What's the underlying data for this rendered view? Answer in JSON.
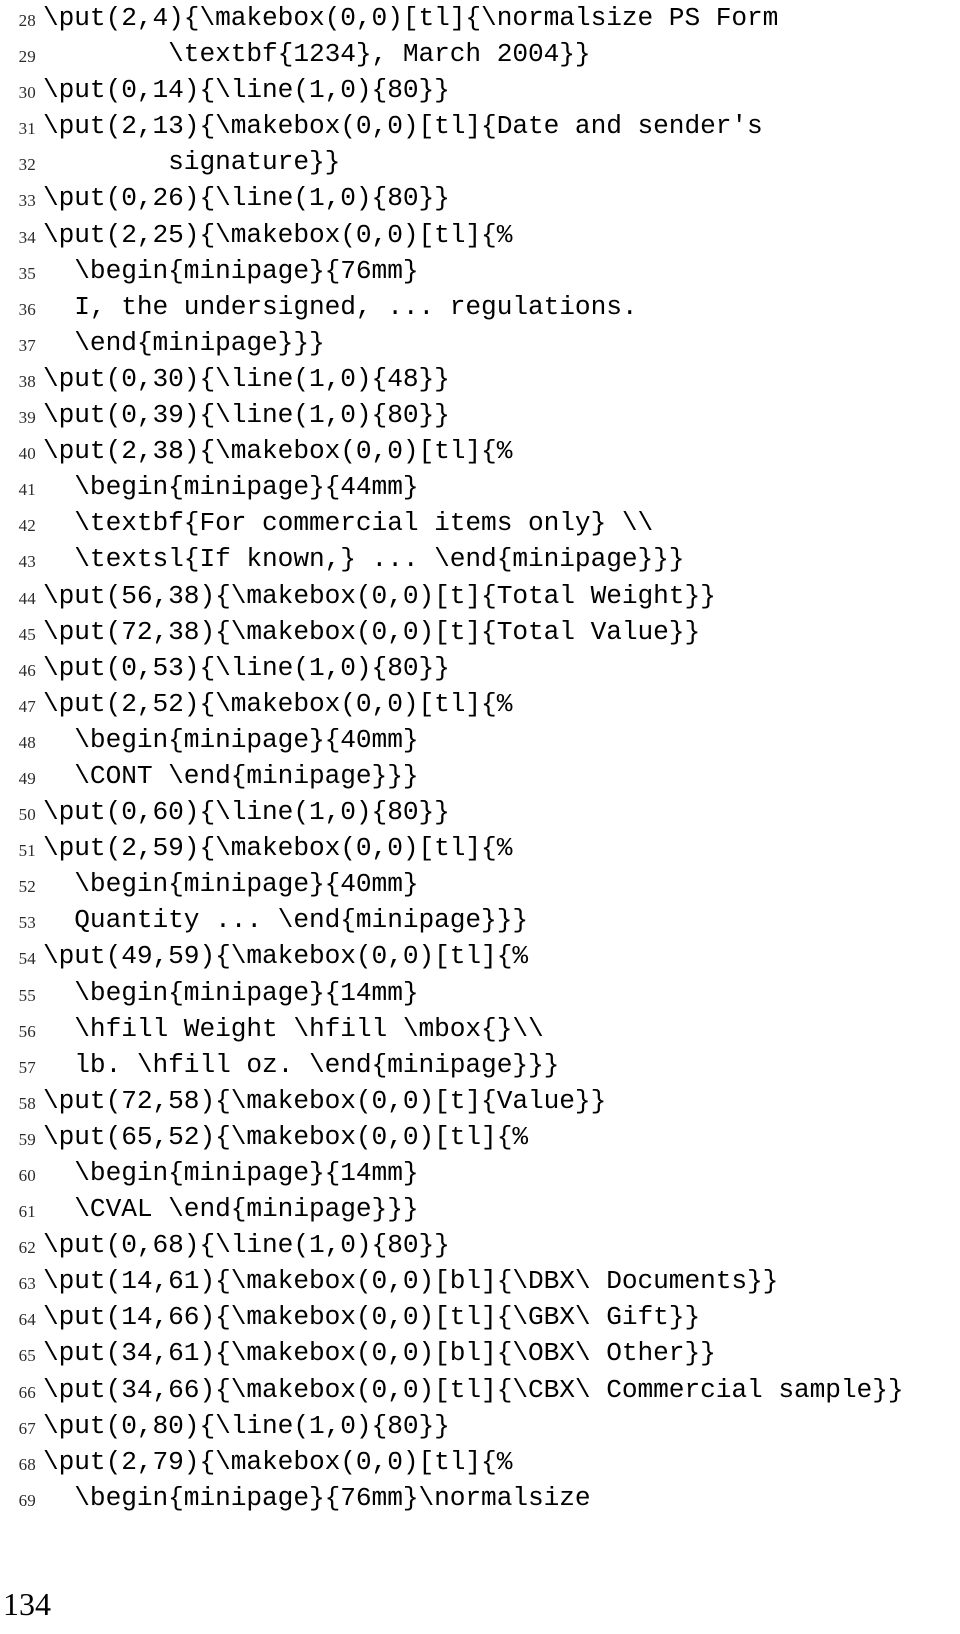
{
  "page": {
    "folio": "134",
    "kind": "code-listing"
  },
  "listing": {
    "first_line_number": 28,
    "lines": [
      {
        "n": "28",
        "code": "\\put(2,4){\\makebox(0,0)[tl]{\\normalsize PS Form"
      },
      {
        "n": "29",
        "code": "        \\textbf{1234}, March 2004}}"
      },
      {
        "n": "30",
        "code": "\\put(0,14){\\line(1,0){80}}"
      },
      {
        "n": "31",
        "code": "\\put(2,13){\\makebox(0,0)[tl]{Date and sender's"
      },
      {
        "n": "32",
        "code": "        signature}}"
      },
      {
        "n": "33",
        "code": "\\put(0,26){\\line(1,0){80}}"
      },
      {
        "n": "34",
        "code": "\\put(2,25){\\makebox(0,0)[tl]{%"
      },
      {
        "n": "35",
        "code": "  \\begin{minipage}{76mm}"
      },
      {
        "n": "36",
        "code": "  I, the undersigned, ... regulations."
      },
      {
        "n": "37",
        "code": "  \\end{minipage}}}"
      },
      {
        "n": "38",
        "code": "\\put(0,30){\\line(1,0){48}}"
      },
      {
        "n": "39",
        "code": "\\put(0,39){\\line(1,0){80}}"
      },
      {
        "n": "40",
        "code": "\\put(2,38){\\makebox(0,0)[tl]{%"
      },
      {
        "n": "41",
        "code": "  \\begin{minipage}{44mm}"
      },
      {
        "n": "42",
        "code": "  \\textbf{For commercial items only} \\\\"
      },
      {
        "n": "43",
        "code": "  \\textsl{If known,} ... \\end{minipage}}}"
      },
      {
        "n": "44",
        "code": "\\put(56,38){\\makebox(0,0)[t]{Total Weight}}"
      },
      {
        "n": "45",
        "code": "\\put(72,38){\\makebox(0,0)[t]{Total Value}}"
      },
      {
        "n": "46",
        "code": "\\put(0,53){\\line(1,0){80}}"
      },
      {
        "n": "47",
        "code": "\\put(2,52){\\makebox(0,0)[tl]{%"
      },
      {
        "n": "48",
        "code": "  \\begin{minipage}{40mm}"
      },
      {
        "n": "49",
        "code": "  \\CONT \\end{minipage}}}"
      },
      {
        "n": "50",
        "code": "\\put(0,60){\\line(1,0){80}}"
      },
      {
        "n": "51",
        "code": "\\put(2,59){\\makebox(0,0)[tl]{%"
      },
      {
        "n": "52",
        "code": "  \\begin{minipage}{40mm}"
      },
      {
        "n": "53",
        "code": "  Quantity ... \\end{minipage}}}"
      },
      {
        "n": "54",
        "code": "\\put(49,59){\\makebox(0,0)[tl]{%"
      },
      {
        "n": "55",
        "code": "  \\begin{minipage}{14mm}"
      },
      {
        "n": "56",
        "code": "  \\hfill Weight \\hfill \\mbox{}\\\\"
      },
      {
        "n": "57",
        "code": "  lb. \\hfill oz. \\end{minipage}}}"
      },
      {
        "n": "58",
        "code": "\\put(72,58){\\makebox(0,0)[t]{Value}}"
      },
      {
        "n": "59",
        "code": "\\put(65,52){\\makebox(0,0)[tl]{%"
      },
      {
        "n": "60",
        "code": "  \\begin{minipage}{14mm}"
      },
      {
        "n": "61",
        "code": "  \\CVAL \\end{minipage}}}"
      },
      {
        "n": "62",
        "code": "\\put(0,68){\\line(1,0){80}}"
      },
      {
        "n": "63",
        "code": "\\put(14,61){\\makebox(0,0)[bl]{\\DBX\\ Documents}}"
      },
      {
        "n": "64",
        "code": "\\put(14,66){\\makebox(0,0)[tl]{\\GBX\\ Gift}}"
      },
      {
        "n": "65",
        "code": "\\put(34,61){\\makebox(0,0)[bl]{\\OBX\\ Other}}"
      },
      {
        "n": "66",
        "code": "\\put(34,66){\\makebox(0,0)[tl]{\\CBX\\ Commercial sample}}"
      },
      {
        "n": "67",
        "code": "\\put(0,80){\\line(1,0){80}}"
      },
      {
        "n": "68",
        "code": "\\put(2,79){\\makebox(0,0)[tl]{%"
      },
      {
        "n": "69",
        "code": "  \\begin{minipage}{76mm}\\normalsize"
      }
    ]
  }
}
